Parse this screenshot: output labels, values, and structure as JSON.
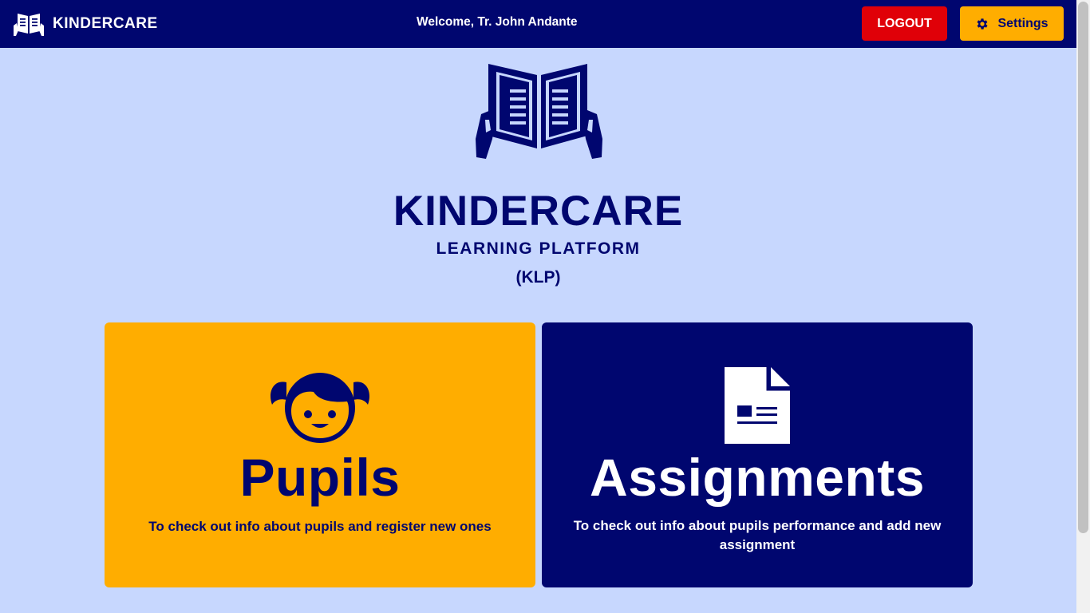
{
  "header": {
    "brand_name": "KINDERCARE",
    "brand_icon": "book-reader-icon",
    "welcome_text": "Welcome, Tr. John Andante",
    "logout_label": "LOGOUT",
    "settings_label": "Settings",
    "settings_icon": "gear-icon"
  },
  "hero": {
    "icon": "book-reader-icon",
    "title": "KINDERCARE",
    "subtitle": "LEARNING PLATFORM",
    "abbreviation": "(KLP)"
  },
  "cards": [
    {
      "icon": "child-face-icon",
      "title": "Pupils",
      "description": "To check out info about pupils and register new ones"
    },
    {
      "icon": "document-icon",
      "title": "Assignments",
      "description": "To check out info about pupils performance and add new assignment"
    }
  ],
  "colors": {
    "navy": "#00066f",
    "background": "#c7d7fe",
    "amber": "#ffad00",
    "red": "#e00008",
    "white": "#ffffff"
  }
}
